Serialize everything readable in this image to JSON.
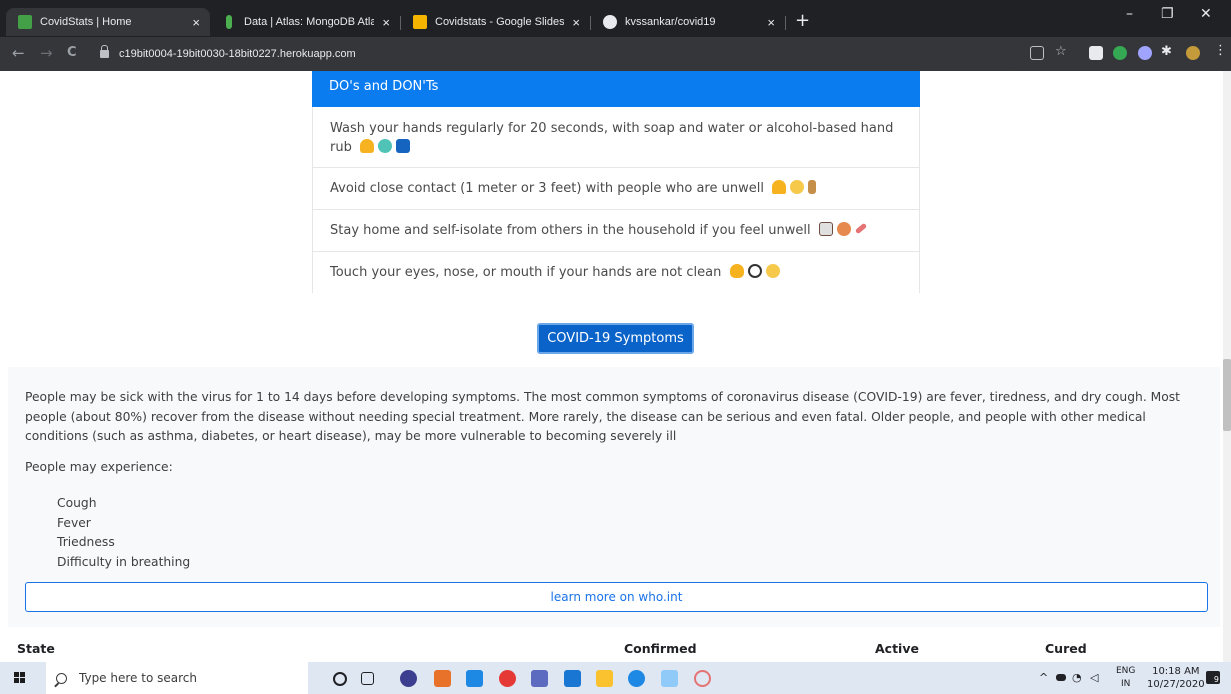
{
  "browser": {
    "tabs": [
      {
        "label": "CovidStats | Home",
        "icon": "covidstats-favicon",
        "color": "#43a047"
      },
      {
        "label": "Data | Atlas: MongoDB Atlas",
        "icon": "mongodb-leaf-icon",
        "color": "#4caf50"
      },
      {
        "label": "Covidstats - Google Slides",
        "icon": "google-slides-icon",
        "color": "#f4b400"
      },
      {
        "label": "kvssankar/covid19",
        "icon": "github-icon",
        "color": "#e8eaed"
      }
    ],
    "close_glyph": "×",
    "newtab_glyph": "+",
    "url": "c19bit0004-19bit0030-18bit0227.herokuapp.com",
    "back_glyph": "←",
    "forward_glyph": "→",
    "reload_glyph": "C",
    "minimize_glyph": "–",
    "restore_glyph": "❐",
    "window_close_glyph": "✕"
  },
  "dos_donts": {
    "header": "DO's and DON'Ts",
    "items": [
      "Wash your hands regularly for 20 seconds, with soap and water or alcohol-based hand rub",
      "Avoid close contact (1 meter or 3 feet) with people who are unwell",
      "Stay home and self-isolate from others in the household if you feel unwell",
      "Touch your eyes, nose, or mouth if your hands are not clean"
    ]
  },
  "symptoms": {
    "button_label": "COVID-19 Symptoms",
    "paragraph": "People may be sick with the virus for 1 to 14 days before developing symptoms. The most common symptoms of coronavirus disease (COVID-19) are fever, tiredness, and dry cough. Most people (about 80%) recover from the disease without needing special treatment. More rarely, the disease can be serious and even fatal. Older people, and people with other medical conditions (such as asthma, diabetes, or heart disease), may be more vulnerable to becoming severely ill",
    "experience_label": "People may experience:",
    "list": [
      "Cough",
      "Fever",
      "Triedness",
      "Difficulty in breathing"
    ],
    "learn_more": "learn more on who.int"
  },
  "table": {
    "headers": [
      "State",
      "Confirmed",
      "Active",
      "Cured"
    ]
  },
  "taskbar": {
    "search_placeholder": "Type here to search",
    "lang_top": "ENG",
    "lang_bottom": "IN",
    "time": "10:18 AM",
    "date": "10/27/2020",
    "notification_count": "9"
  },
  "colors": {
    "primary": "#0a7cf0",
    "button": "#0a63c9",
    "link": "#1a73e8"
  }
}
